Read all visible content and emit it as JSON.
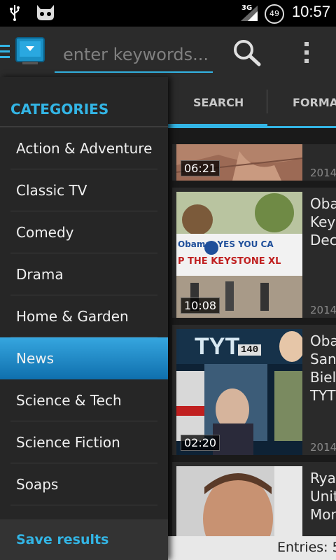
{
  "status_bar": {
    "network": "3G",
    "battery": "49",
    "time": "10:57"
  },
  "search": {
    "placeholder": "enter keywords..."
  },
  "categories": {
    "header": "CATEGORIES",
    "items": [
      {
        "label": "Action & Adventure"
      },
      {
        "label": "Classic TV"
      },
      {
        "label": "Comedy"
      },
      {
        "label": "Drama"
      },
      {
        "label": "Home & Garden"
      },
      {
        "label": "News"
      },
      {
        "label": "Science & Tech"
      },
      {
        "label": "Science Fiction"
      },
      {
        "label": "Soaps"
      }
    ],
    "selected": "News",
    "save_label": "Save results"
  },
  "tabs": {
    "search_label": "SEARCH",
    "format_label": "FORMA"
  },
  "videos": [
    {
      "duration": "06:21",
      "title_lines": [],
      "date": "2014"
    },
    {
      "duration": "10:08",
      "title_lines": [
        "Oba",
        "Key",
        "Dec"
      ],
      "date": "2014",
      "banner_text": "Obama: YES YOU CA",
      "banner_text2": "P THE KEYSTONE XL"
    },
    {
      "duration": "02:20",
      "title_lines": [
        "Oba",
        "San",
        "Biel",
        "TYT"
      ],
      "date": "2014",
      "logo_text": "TYT",
      "counter_text": "140"
    },
    {
      "duration": "",
      "title_lines": [
        "Rya",
        "Unit",
        "Mon"
      ],
      "date": ""
    }
  ],
  "entries": {
    "label": "Entries: 5"
  },
  "colors": {
    "accent": "#33b5e5",
    "selected_gradient_top": "#36a6df",
    "selected_gradient_bottom": "#0f6fad"
  }
}
